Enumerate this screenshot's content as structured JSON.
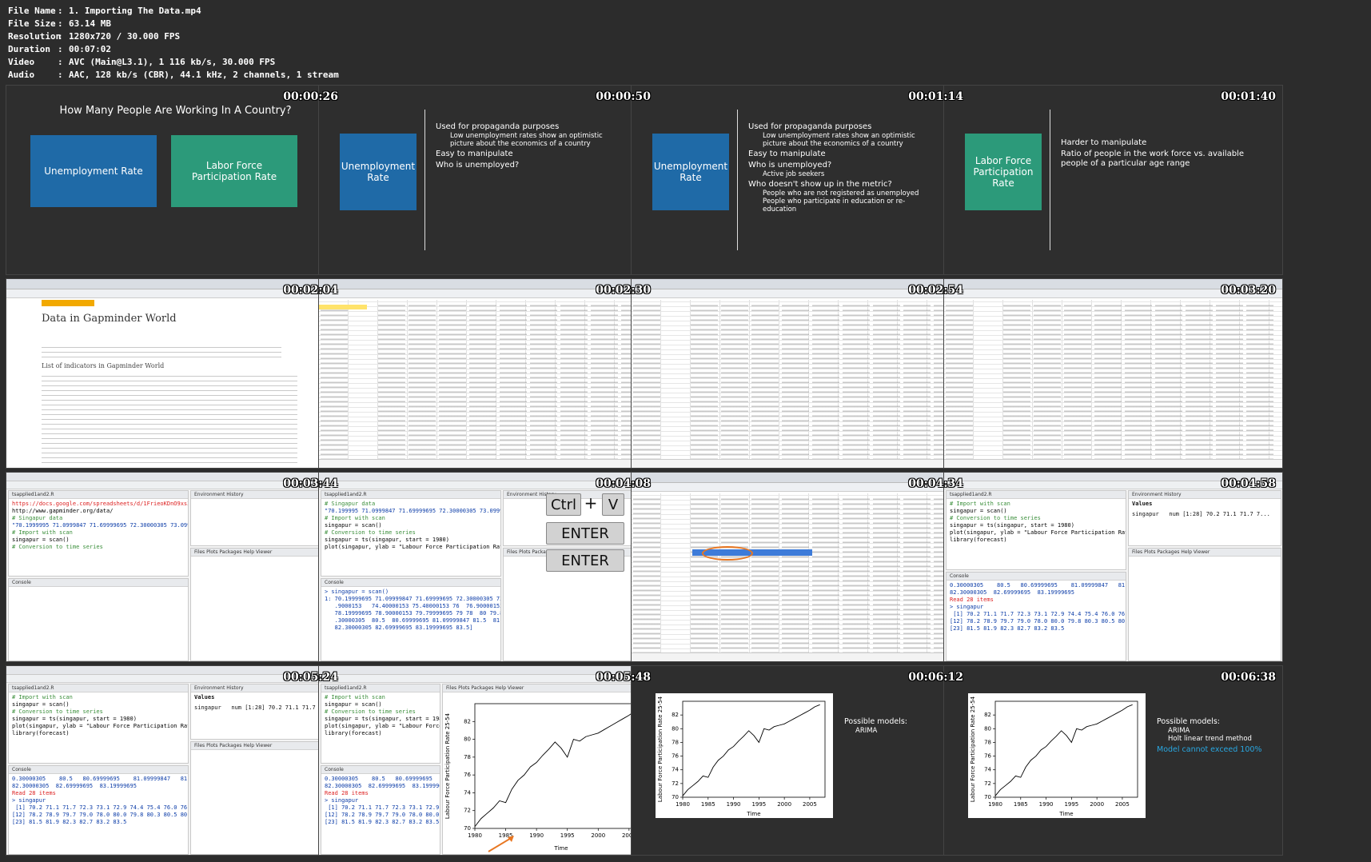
{
  "meta": [
    {
      "key": "File Name",
      "value": "1. Importing The Data.mp4"
    },
    {
      "key": "File Size",
      "value": "63.14 MB"
    },
    {
      "key": "Resolution",
      "value": "1280x720 / 30.000 FPS"
    },
    {
      "key": "Duration",
      "value": "00:07:02"
    },
    {
      "key": "Video",
      "value": "AVC (Main@L3.1), 1 116 kb/s, 30.000 FPS"
    },
    {
      "key": "Audio",
      "value": "AAC, 128 kb/s (CBR), 44.1 kHz, 2 channels, 1 stream"
    }
  ],
  "colon": ":",
  "timestamps": [
    "00:00:26",
    "00:00:50",
    "00:01:14",
    "00:01:40",
    "00:02:04",
    "00:02:30",
    "00:02:54",
    "00:03:20",
    "00:03:44",
    "00:04:08",
    "00:04:34",
    "00:04:58",
    "00:05:24",
    "00:05:48",
    "00:06:12",
    "00:06:38"
  ],
  "slide1": {
    "title": "How Many People Are Working In A Country?",
    "box_unemployment": "Unemployment Rate",
    "box_lfpr": "Labor Force Participation Rate"
  },
  "slide2": {
    "box": "Unemployment Rate",
    "b1": "Used for propaganda purposes",
    "b1a": "Low unemployment rates show an optimistic picture about the economics of a country",
    "b2": "Easy to manipulate",
    "b3": "Who is unemployed?"
  },
  "slide3": {
    "box": "Unemployment Rate",
    "b1": "Used for propaganda purposes",
    "b1a": "Low unemployment rates show an optimistic picture about the economics of a country",
    "b2": "Easy to manipulate",
    "b3": "Who is unemployed?",
    "b3a": "Active job seekers",
    "b4": "Who doesn't show up in the metric?",
    "b4a": "People who are not registered as unemployed",
    "b4b": "People who participate in education or re-education"
  },
  "slide4": {
    "box": "Labor Force Participation Rate",
    "b1": "Harder to manipulate",
    "b2": "Ratio of people in the work force vs. available people of a particular age range"
  },
  "gapminder": {
    "logo": "GAPMINDER",
    "title": "Data in Gapminder World",
    "list_title": "List of indicators in Gapminder World"
  },
  "rstudio": {
    "code1": [
      {
        "t": "https://docs.google.com/spreadsheets/d/1FrieoKDnO9xs3vCzy",
        "c": "red"
      },
      {
        "t": "http://www.gapminder.org/data/",
        "c": "fn"
      },
      {
        "t": "# Singapur data",
        "c": "cm"
      },
      {
        "t": "\"70.1999995 71.0999847 71.69999695 72.30000305 73.09999",
        "c": "str"
      },
      {
        "t": "# Import with scan",
        "c": "cm"
      },
      {
        "t": "singapur = scan()",
        "c": "fn"
      },
      {
        "t": "# Conversion to time series",
        "c": "cm"
      }
    ],
    "code2": [
      {
        "t": "# Singapur data",
        "c": "cm"
      },
      {
        "t": "\"70.199995 71.0999847 71.69999695 72.30000305 73.09999",
        "c": "str"
      },
      {
        "t": "# Import with scan",
        "c": "cm"
      },
      {
        "t": "singapur = scan()",
        "c": "fn"
      },
      {
        "t": "# Conversion to time series",
        "c": "cm"
      },
      {
        "t": "singapur = ts(singapur, start = 1980)",
        "c": "fn"
      },
      {
        "t": "plot(singapur, ylab = \"Labour Force Participation Rate 25-",
        "c": "fn"
      }
    ],
    "console2": [
      {
        "t": "> singapur = scan()",
        "c": "cons"
      },
      {
        "t": "1: 70.19999695 71.09999847 71.69999695 72.30000305 73.09999847 74",
        "c": "cons"
      },
      {
        "t": "   .9000153   74.40000153 75.40000153 76  76.90000153 77.40000153",
        "c": "cons"
      },
      {
        "t": "   78.19999695 78.90000153 79.79999695 79 78  80 79.80000305 80.5",
        "c": "cons"
      },
      {
        "t": "   .30000305  80.5  80.69999695 81.09999847 81.5  81.90000153",
        "c": "cons"
      },
      {
        "t": "   82.30000305 82.69999695 83.19999695 83.5]",
        "c": "cons"
      }
    ],
    "keys": [
      "Ctrl",
      "+",
      "V",
      "ENTER",
      "ENTER"
    ],
    "code4": [
      {
        "t": "# Import with scan",
        "c": "cm"
      },
      {
        "t": "singapur = scan()",
        "c": "fn"
      },
      {
        "t": "# Conversion to time series",
        "c": "cm"
      },
      {
        "t": "singapur = ts(singapur, start = 1980)",
        "c": "fn"
      },
      {
        "t": "plot(singapur, ylab = \"Labour Force Participation Rate 25-",
        "c": "fn"
      },
      {
        "t": "library(forecast)",
        "c": "fn"
      }
    ],
    "console4": [
      {
        "t": "0.30000305    80.5   80.69999695    81.09999847   81.5",
        "c": "cons"
      },
      {
        "t": "82.30000305  82.69999695  83.19999695",
        "c": "cons"
      },
      {
        "t": "Read 28 items",
        "c": "red"
      },
      {
        "t": "> singapur",
        "c": "cons"
      },
      {
        "t": " [1] 70.2 71.1 71.7 72.3 73.1 72.9 74.4 75.4 76.0 76.9 77.4",
        "c": "cons"
      },
      {
        "t": "[12] 78.2 78.9 79.7 79.0 78.0 80.0 79.8 80.3 80.5 80.7 81.1",
        "c": "cons"
      },
      {
        "t": "[23] 81.5 81.9 82.3 82.7 83.2 83.5",
        "c": "cons"
      }
    ],
    "env_values": "Values",
    "env_singapur": "singapur   num [1:28] 70.2 71.1 71.7 7..."
  },
  "plotnote1": {
    "title": "Possible models:",
    "items": [
      "ARIMA"
    ]
  },
  "plotnote2": {
    "title": "Possible models:",
    "items": [
      "ARIMA",
      "Holt linear trend method"
    ],
    "highlight": "Model cannot exceed 100%"
  },
  "chart_data": {
    "type": "line",
    "x": [
      1980,
      1981,
      1982,
      1983,
      1984,
      1985,
      1986,
      1987,
      1988,
      1989,
      1990,
      1991,
      1992,
      1993,
      1994,
      1995,
      1996,
      1997,
      1998,
      1999,
      2000,
      2001,
      2002,
      2003,
      2004,
      2005,
      2006,
      2007
    ],
    "values": [
      70.2,
      71.1,
      71.7,
      72.3,
      73.1,
      72.9,
      74.4,
      75.4,
      76.0,
      76.9,
      77.4,
      78.2,
      78.9,
      79.7,
      79.0,
      78.0,
      80.0,
      79.8,
      80.3,
      80.5,
      80.7,
      81.1,
      81.5,
      81.9,
      82.3,
      82.7,
      83.2,
      83.5
    ],
    "xlabel": "Time",
    "ylabel": "Labour Force Participation Rate 25-54",
    "xticks": [
      "1980",
      "1985",
      "1990",
      "1995",
      "2000",
      "2005"
    ],
    "yticks": [
      "70",
      "72",
      "74",
      "76",
      "78",
      "80",
      "82"
    ],
    "ylim": [
      70,
      84
    ]
  }
}
